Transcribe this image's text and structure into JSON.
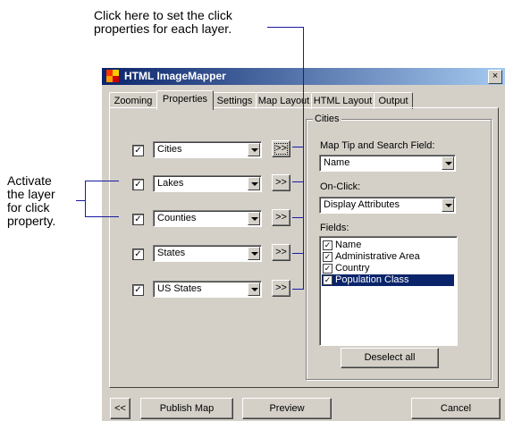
{
  "callouts": {
    "top_line1": "Click here to set the click",
    "top_line2": "properties for each layer.",
    "left_line1": "Activate",
    "left_line2": "the layer",
    "left_line3": "for click",
    "left_line4": "property."
  },
  "window": {
    "title": "HTML ImageMapper",
    "close_glyph": "×"
  },
  "tabs": [
    "Zooming",
    "Properties",
    "Settings",
    "Map Layout",
    "HTML Layout",
    "Output"
  ],
  "selected_tab": "Properties",
  "layers": [
    {
      "name": "Cities",
      "checked": "✓"
    },
    {
      "name": "Lakes",
      "checked": "✓"
    },
    {
      "name": "Counties",
      "checked": "✓"
    },
    {
      "name": "States",
      "checked": "✓"
    },
    {
      "name": "US States",
      "checked": "✓"
    }
  ],
  "layer_button_label": ">>",
  "cities_group": {
    "title": "Cities",
    "map_tip_label": "Map Tip and Search Field:",
    "map_tip_value": "Name",
    "on_click_label": "On-Click:",
    "on_click_value": "Display Attributes",
    "fields_label": "Fields:",
    "fields": [
      {
        "name": "Name",
        "checked": "✓",
        "selected": false
      },
      {
        "name": "Administrative Area",
        "checked": "✓",
        "selected": false
      },
      {
        "name": "Country",
        "checked": "✓",
        "selected": false
      },
      {
        "name": "Population Class",
        "checked": "✓",
        "selected": true
      }
    ],
    "deselect_all_label": "Deselect all"
  },
  "footer": {
    "back_label": "<<",
    "publish_label": "Publish Map",
    "preview_label": "Preview",
    "cancel_label": "Cancel"
  },
  "colors": {
    "title_bar": "#0a246a",
    "selection": "#0a246a",
    "callout_line": "#1a1aa0"
  }
}
